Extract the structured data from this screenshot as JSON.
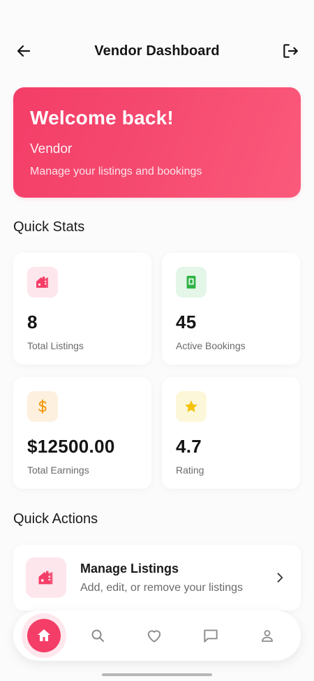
{
  "header": {
    "title": "Vendor Dashboard",
    "back_icon": "arrow-left-icon",
    "logout_icon": "logout-icon"
  },
  "welcome": {
    "heading": "Welcome back!",
    "name": "Vendor",
    "subtitle": "Manage your listings and bookings"
  },
  "quick_stats": {
    "title": "Quick Stats",
    "cards": [
      {
        "value": "8",
        "label": "Total Listings",
        "icon": "house-icon",
        "color": "#f43e68"
      },
      {
        "value": "45",
        "label": "Active Bookings",
        "icon": "booking-icon",
        "color": "#2fb344"
      },
      {
        "value": "$12500.00",
        "label": "Total Earnings",
        "icon": "dollar-icon",
        "color": "#f39c12"
      },
      {
        "value": "4.7",
        "label": "Rating",
        "icon": "star-icon",
        "color": "#f1c40f"
      }
    ]
  },
  "quick_actions": {
    "title": "Quick Actions",
    "items": [
      {
        "title": "Manage Listings",
        "subtitle": "Add, edit, or remove your listings",
        "icon": "house-icon"
      }
    ]
  },
  "bottom_nav": {
    "items": [
      {
        "icon": "home-icon",
        "active": true
      },
      {
        "icon": "search-icon",
        "active": false
      },
      {
        "icon": "heart-icon",
        "active": false
      },
      {
        "icon": "chat-icon",
        "active": false
      },
      {
        "icon": "profile-icon",
        "active": false
      }
    ]
  },
  "colors": {
    "primary": "#f43e68",
    "primary_light": "#fde6ec",
    "background": "#fbfbfb"
  }
}
